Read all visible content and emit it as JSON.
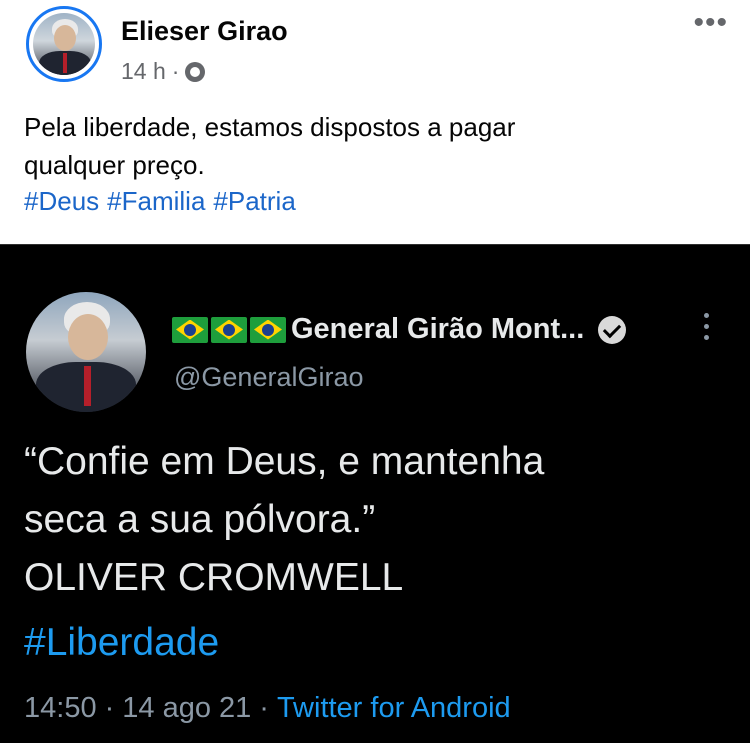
{
  "fb_post": {
    "author_name": "Elieser Girao",
    "time": "14 h",
    "separator": "·",
    "privacy_icon": "globe-icon",
    "more_icon": "•••",
    "text_line1": "Pela liberdade, estamos dispostos a pagar",
    "text_line2": "qualquer preço.",
    "hashtags": [
      "#Deus",
      "#Familia",
      "#Patria"
    ]
  },
  "tweet": {
    "display_name": "General Girão Mont...",
    "flag_count": 3,
    "verified_icon": "verified-badge-icon",
    "handle": "@GeneralGirao",
    "text_line1": "“Confie em Deus, e mantenha",
    "text_line2": "seca a sua pólvora.”",
    "text_line3": "OLIVER CROMWELL",
    "hashtag": "#Liberdade",
    "time": "14:50",
    "dot1": "·",
    "date": "14 ago 21",
    "dot2": "·",
    "source": "Twitter for Android"
  },
  "colors": {
    "fb_link": "#1b66c9",
    "tw_link": "#1d9bf0",
    "tw_bg": "#000000"
  }
}
